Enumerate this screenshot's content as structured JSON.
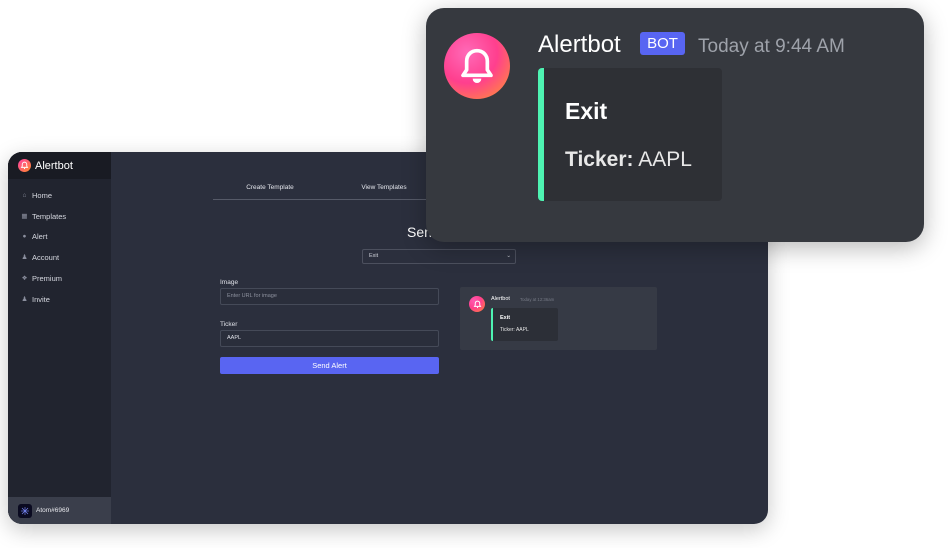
{
  "app": {
    "brand": "Alertbot",
    "nav": [
      {
        "label": "Home",
        "icon": "home-icon"
      },
      {
        "label": "Templates",
        "icon": "templates-icon"
      },
      {
        "label": "Alert",
        "icon": "alert-icon"
      },
      {
        "label": "Account",
        "icon": "account-icon"
      },
      {
        "label": "Premium",
        "icon": "premium-icon"
      },
      {
        "label": "Invite",
        "icon": "invite-icon"
      }
    ],
    "user": {
      "name": "Atom#6969",
      "avatar": "user-avatar-icon"
    },
    "tabs": [
      "Create Template",
      "View Templates"
    ],
    "page_title": "Sen",
    "template_select": {
      "value": "Exit"
    },
    "form": {
      "image_label": "Image",
      "image_placeholder": "Enter URL for image",
      "ticker_label": "Ticker",
      "ticker_value": "AAPL",
      "send_button": "Send Alert"
    },
    "preview": {
      "bot_name": "Alertbot",
      "timestamp": "Today at 12:36am",
      "embed_title": "Exit",
      "field_name": "Ticker:",
      "field_value": "AAPL"
    }
  },
  "message_card": {
    "bot_name": "Alertbot",
    "badge": "BOT",
    "timestamp": "Today at 9:44 AM",
    "embed_title": "Exit",
    "field_name": "Ticker:",
    "field_value": "AAPL"
  },
  "colors": {
    "accent": "#5865f2",
    "embed_bar": "#4ef3b2",
    "brand_gradient_start": "#ff3fa4",
    "brand_gradient_end": "#ff8a2b"
  }
}
